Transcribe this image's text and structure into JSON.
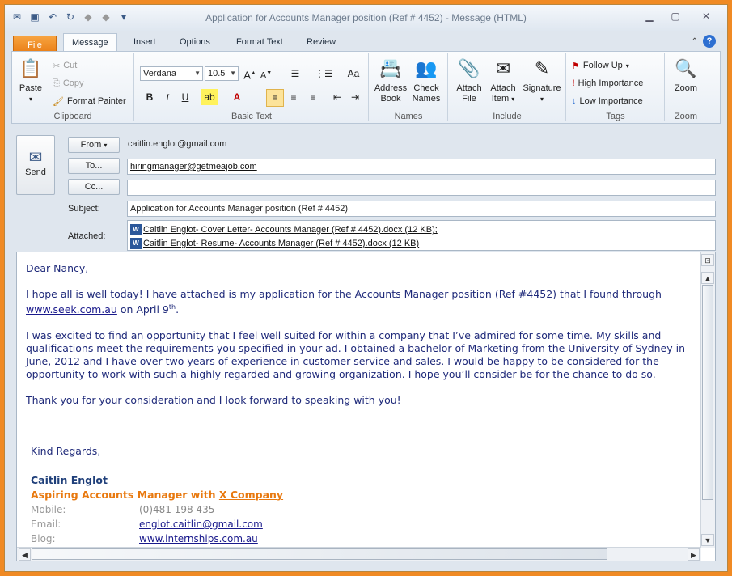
{
  "window": {
    "title": "Application for Accounts Manager position (Ref # 4452)  -  Message (HTML)"
  },
  "tabs": [
    "File",
    "Message",
    "Insert",
    "Options",
    "Format Text",
    "Review"
  ],
  "ribbon": {
    "clipboard": {
      "paste": "Paste",
      "cut": "Cut",
      "copy": "Copy",
      "format_painter": "Format Painter",
      "label": "Clipboard"
    },
    "basic_text": {
      "font": "Verdana",
      "size": "10.5",
      "label": "Basic Text"
    },
    "names": {
      "address_book": "Address Book",
      "check_names": "Check Names",
      "label": "Names"
    },
    "include": {
      "attach_file": "Attach File",
      "attach_item": "Attach Item",
      "signature": "Signature",
      "label": "Include"
    },
    "tags": {
      "follow_up": "Follow Up",
      "high": "High Importance",
      "low": "Low Importance",
      "label": "Tags"
    },
    "zoom": {
      "zoom": "Zoom",
      "label": "Zoom"
    }
  },
  "header": {
    "send": "Send",
    "from_button": "From",
    "from_value": "caitlin.englot@gmail.com",
    "to_button": "To...",
    "to_value": "hiringmanager@getmeajob.com",
    "cc_button": "Cc...",
    "cc_value": "",
    "subject_label": "Subject:",
    "subject_value": "Application for Accounts Manager position (Ref # 4452)",
    "attached_label": "Attached:",
    "attachments": [
      "Caitlin Englot- Cover Letter- Accounts Manager (Ref # 4452).docx (12 KB);",
      "Caitlin Englot- Resume- Accounts Manager (Ref # 4452).docx (12 KB)"
    ]
  },
  "body": {
    "greeting": "Dear Nancy,",
    "p1_before": "I hope all is well today! I have attached is my application for the Accounts Manager position (Ref #4452) that I found through ",
    "p1_link": "www.seek.com.au",
    "p1_after": " on April 9",
    "p1_sup": "th",
    "p1_end": ".",
    "p2": "I was excited to find an opportunity that I feel well suited for within a company that I’ve admired for some time. My skills and qualifications meet the requirements you specified in your ad. I obtained a bachelor of Marketing from the University of Sydney in June, 2012 and I have over two years of experience in customer service and sales. I would be happy to be considered for the opportunity to work with such a highly regarded and growing organization. I hope you’ll consider be for the chance to do so.",
    "p3": "Thank you for your consideration and I look forward to speaking with you!",
    "closing": "Kind Regards,"
  },
  "signature": {
    "name": "Caitlin Englot",
    "tagline_before": "Aspiring Accounts Manager with ",
    "tagline_link": "X Company",
    "mobile_label": "Mobile:",
    "mobile_value": "(0)481 198 435",
    "email_label": "Email:",
    "email_value": "englot.caitlin@gmail.com",
    "blog_label": "Blog:",
    "blog_value": "www.internships.com.au"
  },
  "colors": {
    "accent": "#f08a24",
    "signature_name": "#1f3f7a",
    "tagline": "#e8790f",
    "body_text": "#1f2a7a"
  }
}
